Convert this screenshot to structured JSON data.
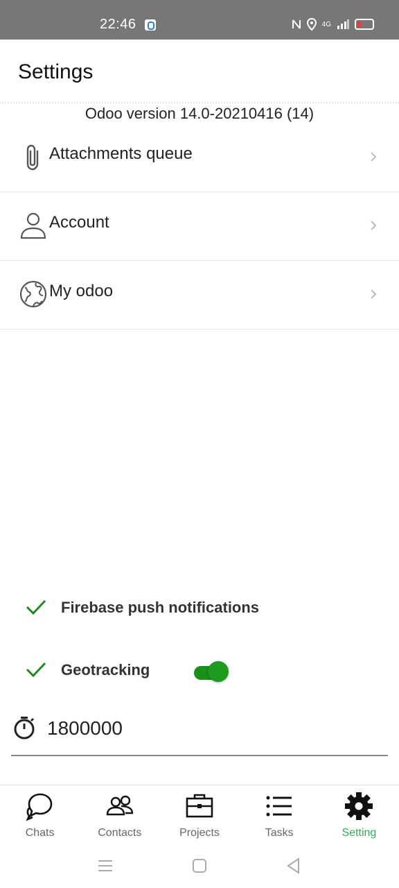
{
  "status_bar": {
    "time": "22:46",
    "network_label": "4G"
  },
  "header": {
    "title": "Settings"
  },
  "version": "Odoo version 14.0-20210416 (14)",
  "menu": [
    {
      "label": "Attachments queue",
      "icon": "paperclip-icon"
    },
    {
      "label": "Account",
      "icon": "person-icon"
    },
    {
      "label": "My odoo",
      "icon": "globe-icon"
    }
  ],
  "options": {
    "firebase": {
      "label": "Firebase push notifications",
      "checked": true
    },
    "geotracking": {
      "label": "Geotracking",
      "checked": true,
      "toggle_on": true
    }
  },
  "interval": {
    "value": "1800000",
    "icon": "timer-icon"
  },
  "tabs": [
    {
      "label": "Chats",
      "icon": "chat-bubbles-icon",
      "active": false
    },
    {
      "label": "Contacts",
      "icon": "contacts-icon",
      "active": false
    },
    {
      "label": "Projects",
      "icon": "briefcase-icon",
      "active": false
    },
    {
      "label": "Tasks",
      "icon": "list-icon",
      "active": false
    },
    {
      "label": "Setting",
      "icon": "gear-icon",
      "active": true
    }
  ],
  "colors": {
    "accent": "#27ae60",
    "toggle": "#1b8f1b",
    "check": "#1e8a1e",
    "status_bar": "#777777"
  }
}
